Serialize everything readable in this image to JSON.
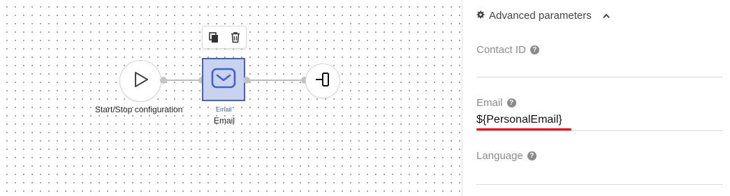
{
  "canvas": {
    "toolbar": {
      "copy_icon": "copy-icon",
      "delete_icon": "trash-icon"
    },
    "nodes": {
      "start": {
        "label": "Start/Stop configuration",
        "icon": "play-icon"
      },
      "email": {
        "type_label": "Email",
        "label": "Email",
        "icon": "envelope-icon",
        "accent": "#3f63c9",
        "fill": "#c9d3ef"
      },
      "end": {
        "icon": "exit-icon"
      }
    }
  },
  "panel": {
    "section_title": "Advanced parameters",
    "fields": [
      {
        "label": "Contact ID",
        "value": ""
      },
      {
        "label": "Email",
        "value": "${PersonalEmail}"
      },
      {
        "label": "Language",
        "value": ""
      }
    ],
    "highlight_color": "#e0141e"
  }
}
